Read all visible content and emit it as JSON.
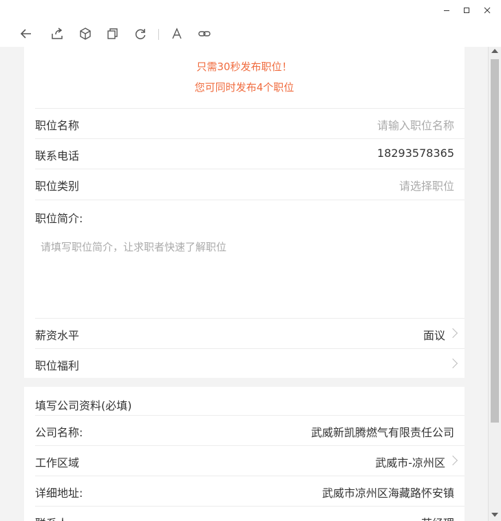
{
  "window": {
    "minimize_icon": "minimize-icon",
    "maximize_icon": "maximize-icon",
    "close_icon": "close-icon"
  },
  "toolbar": {
    "icons": [
      "back-arrow-icon",
      "share-icon",
      "cube-icon",
      "copy-window-icon",
      "refresh-icon",
      "font-size-icon",
      "link-icon"
    ]
  },
  "notice": {
    "line1": "只需30秒发布职位！",
    "line2": "您可同时发布4个职位",
    "color": "#f06b3e"
  },
  "job_form": {
    "name": {
      "label": "职位名称",
      "placeholder": "请输入职位名称"
    },
    "phone": {
      "label": "联系电话",
      "value": "18293578365"
    },
    "category": {
      "label": "职位类别",
      "placeholder": "请选择职位"
    },
    "intro": {
      "label": "职位简介:",
      "placeholder": "请填写职位简介，让求职者快速了解职位"
    },
    "salary": {
      "label": "薪资水平",
      "value": "面议"
    },
    "benefits": {
      "label": "职位福利",
      "value": ""
    }
  },
  "company_form": {
    "section_title": "填写公司资料(必填)",
    "name": {
      "label": "公司名称:",
      "value": "武威新凯腾燃气有限责任公司"
    },
    "region": {
      "label": "工作区域",
      "value": "武威市-凉州区"
    },
    "address": {
      "label": "详细地址:",
      "value": "武威市凉州区海藏路怀安镇"
    },
    "contact": {
      "label": "联系人:",
      "value": "苏经理"
    }
  }
}
